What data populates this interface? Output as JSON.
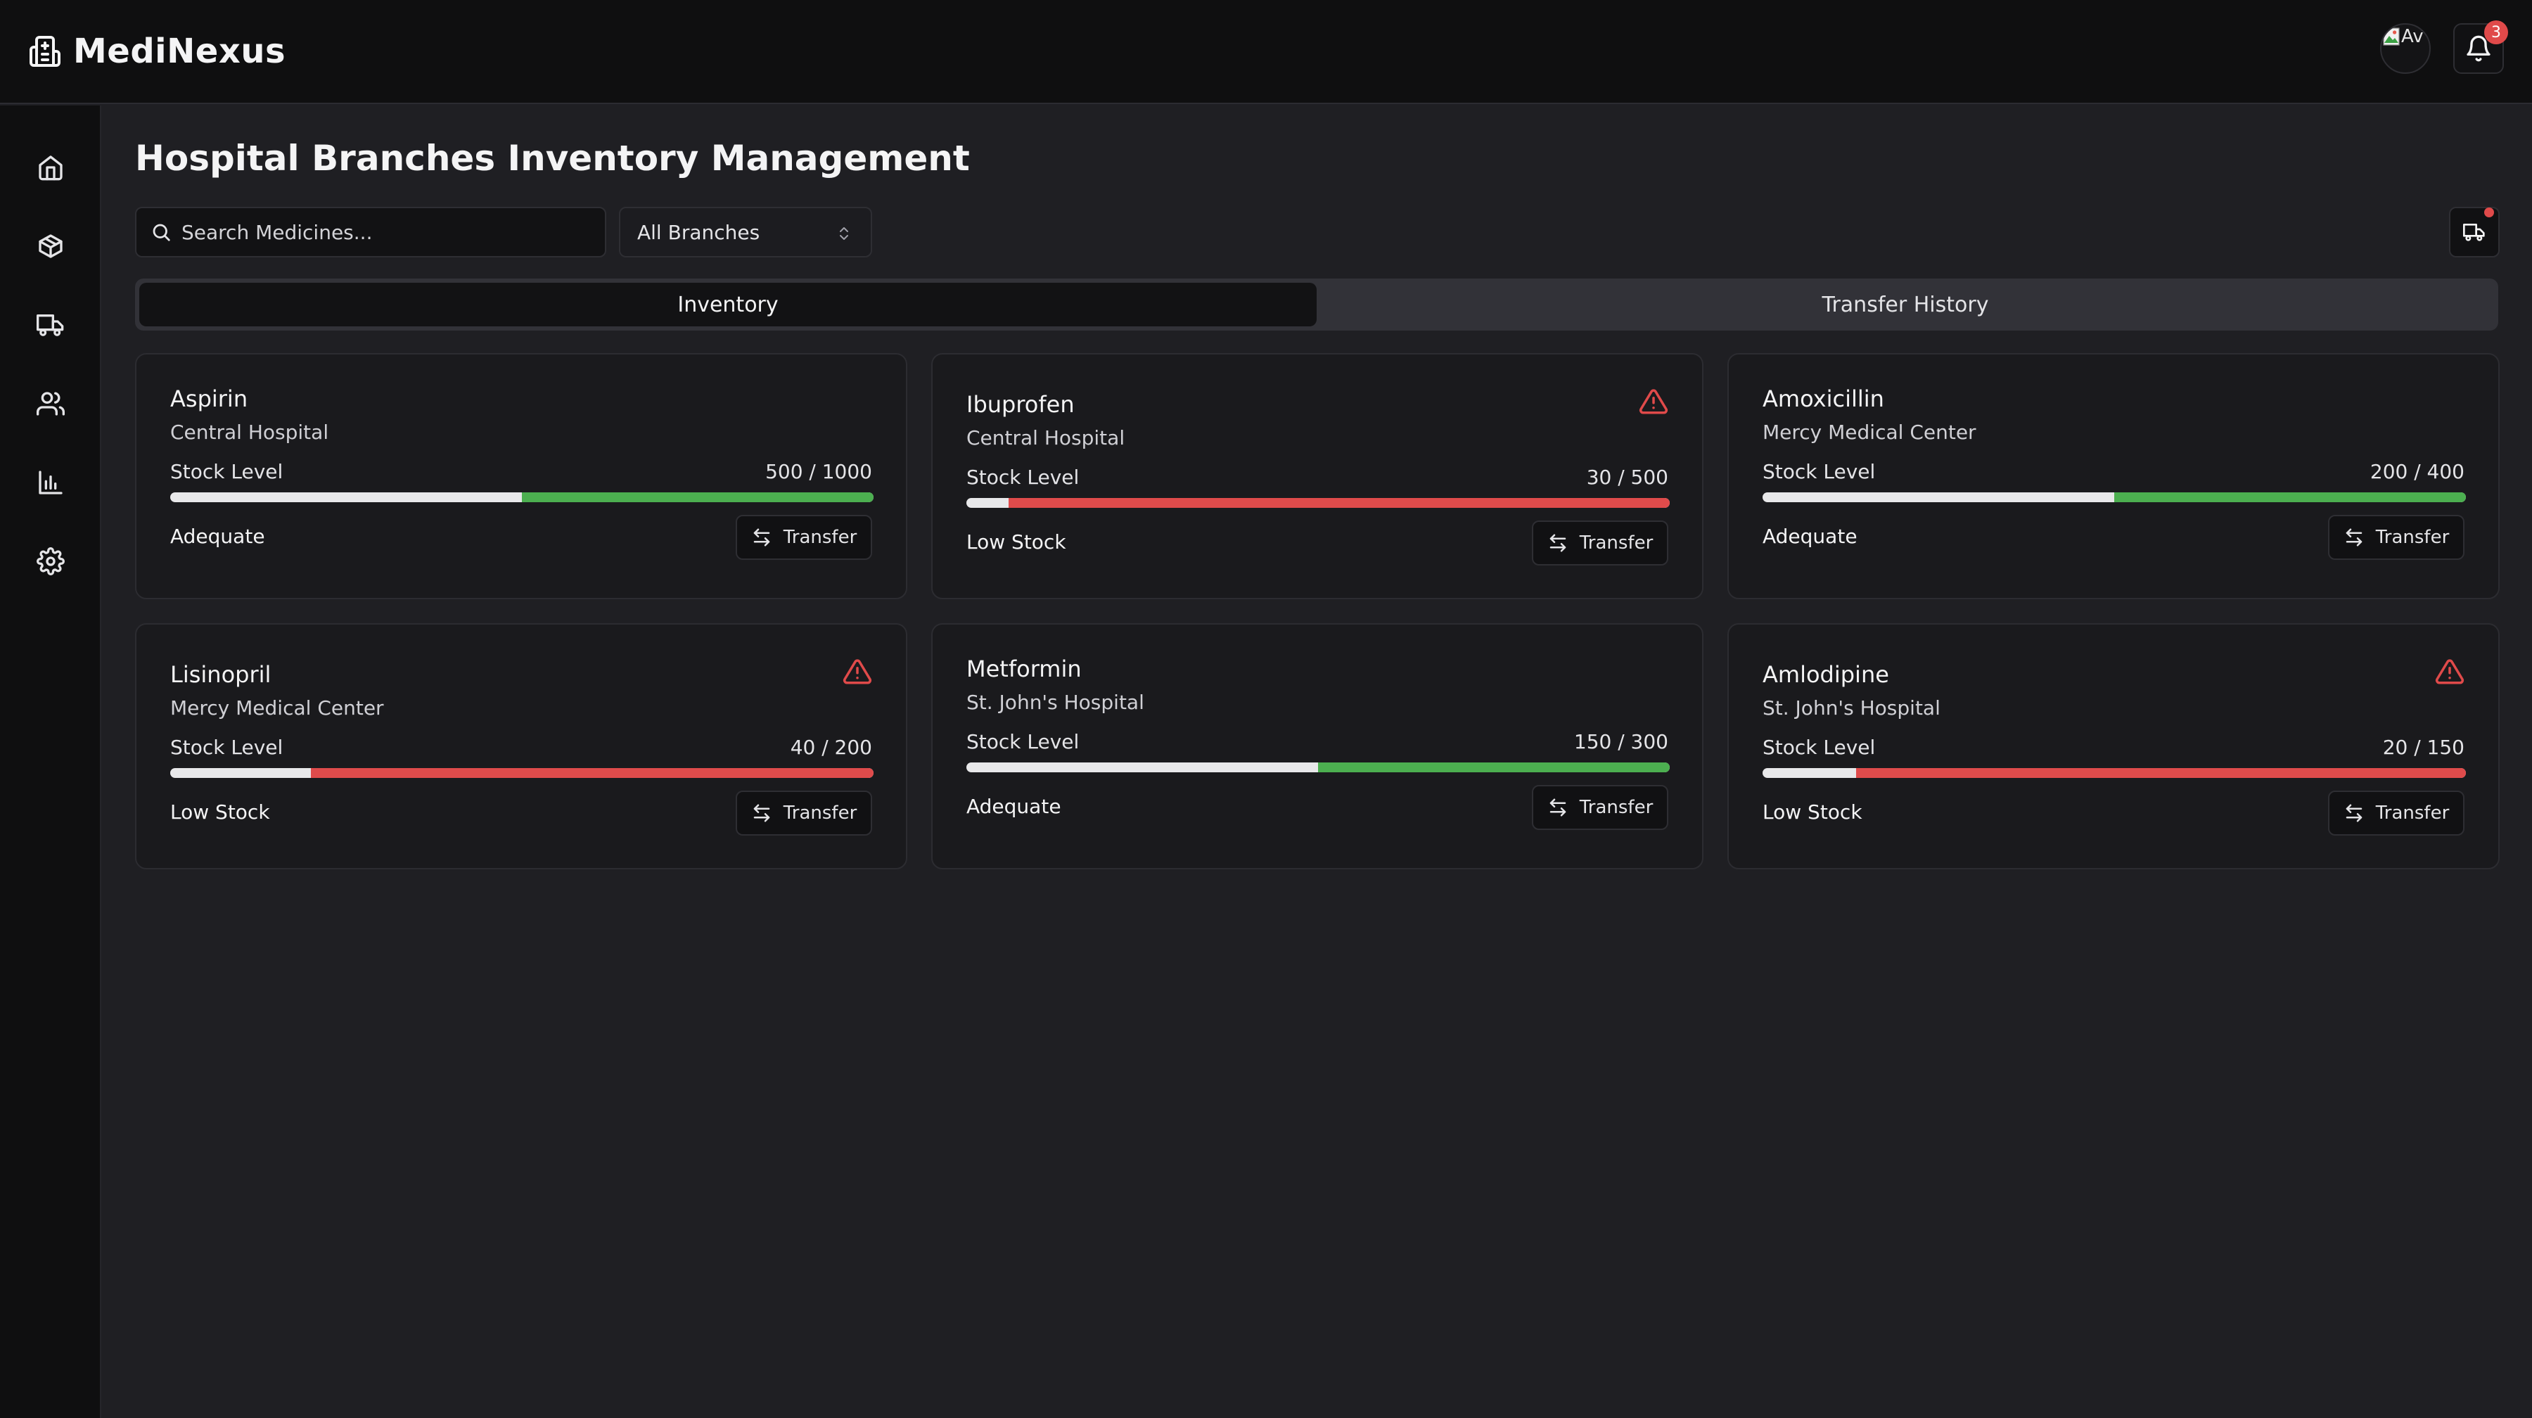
{
  "app": {
    "name": "MediNexus",
    "avatar_alt": "Av",
    "notification_count": "3"
  },
  "page": {
    "title": "Hospital Branches Inventory Management",
    "search_placeholder": "Search Medicines...",
    "branch_filter": "All Branches"
  },
  "tabs": [
    {
      "label": "Inventory",
      "active": true
    },
    {
      "label": "Transfer History",
      "active": false
    }
  ],
  "colors": {
    "adequate": "#4caf50",
    "low": "#df4b4b",
    "warning": "#e04a4a"
  },
  "sidebar": [
    "home-icon",
    "package-icon",
    "truck-icon",
    "users-icon",
    "bar-chart-icon",
    "settings-icon"
  ],
  "medicines": [
    {
      "name": "Aspirin",
      "branch": "Central Hospital",
      "stock_label": "Stock Level",
      "stock_text": "500 / 1000",
      "fill": 0.5,
      "status": "Adequate",
      "low": false,
      "transfer_label": "Transfer"
    },
    {
      "name": "Ibuprofen",
      "branch": "Central Hospital",
      "stock_label": "Stock Level",
      "stock_text": "30 / 500",
      "fill": 0.94,
      "status": "Low Stock",
      "low": true,
      "transfer_label": "Transfer"
    },
    {
      "name": "Amoxicillin",
      "branch": "Mercy Medical Center",
      "stock_label": "Stock Level",
      "stock_text": "200 / 400",
      "fill": 0.5,
      "status": "Adequate",
      "low": false,
      "transfer_label": "Transfer"
    },
    {
      "name": "Lisinopril",
      "branch": "Mercy Medical Center",
      "stock_label": "Stock Level",
      "stock_text": "40 / 200",
      "fill": 0.8,
      "status": "Low Stock",
      "low": true,
      "transfer_label": "Transfer"
    },
    {
      "name": "Metformin",
      "branch": "St. John's Hospital",
      "stock_label": "Stock Level",
      "stock_text": "150 / 300",
      "fill": 0.5,
      "status": "Adequate",
      "low": false,
      "transfer_label": "Transfer"
    },
    {
      "name": "Amlodipine",
      "branch": "St. John's Hospital",
      "stock_label": "Stock Level",
      "stock_text": "20 / 150",
      "fill": 0.867,
      "status": "Low Stock",
      "low": true,
      "transfer_label": "Transfer"
    }
  ]
}
